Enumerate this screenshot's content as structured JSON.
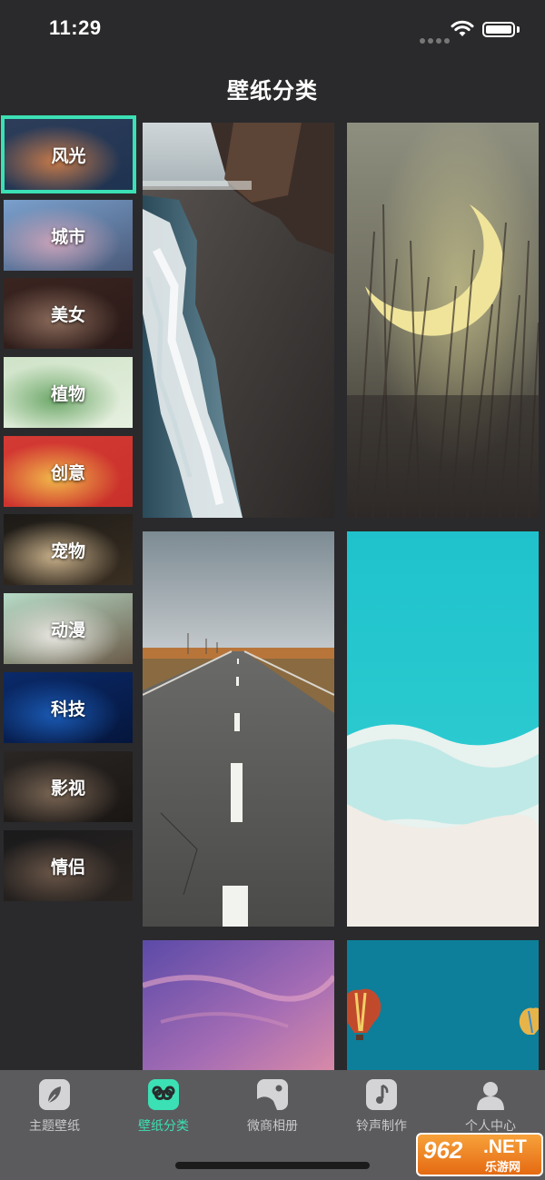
{
  "status_bar": {
    "time": "11:29"
  },
  "nav": {
    "title": "壁纸分类"
  },
  "categories": [
    {
      "label": "风光",
      "active": true,
      "colors": [
        "#2d3d5a",
        "#c67a4a",
        "#1e3350"
      ]
    },
    {
      "label": "城市",
      "active": false,
      "colors": [
        "#7aa0cc",
        "#c9a2b8",
        "#4a5a7a"
      ]
    },
    {
      "label": "美女",
      "active": false,
      "colors": [
        "#3a2420",
        "#8a6a5a",
        "#2a1a18"
      ]
    },
    {
      "label": "植物",
      "active": false,
      "colors": [
        "#cfe3c8",
        "#6ea86a",
        "#e6f0df"
      ]
    },
    {
      "label": "创意",
      "active": false,
      "colors": [
        "#d43a34",
        "#f2b84a",
        "#c9302a"
      ]
    },
    {
      "label": "宠物",
      "active": false,
      "colors": [
        "#1c1a17",
        "#c8b08a",
        "#3a2f22"
      ]
    },
    {
      "label": "动漫",
      "active": false,
      "colors": [
        "#b7dcc8",
        "#e8e6e0",
        "#6a5a48"
      ]
    },
    {
      "label": "科技",
      "active": false,
      "colors": [
        "#0a2a6a",
        "#1a5ab4",
        "#05163c"
      ]
    },
    {
      "label": "影视",
      "active": false,
      "colors": [
        "#2a2624",
        "#7a6654",
        "#1a1614"
      ]
    },
    {
      "label": "情侣",
      "active": false,
      "colors": [
        "#1a1a1c",
        "#6a5648",
        "#2a2420"
      ]
    }
  ],
  "wallpapers": [
    {
      "name": "coast-aerial"
    },
    {
      "name": "moon-grass"
    },
    {
      "name": "desert-road"
    },
    {
      "name": "turquoise-sea"
    },
    {
      "name": "purple-sky"
    },
    {
      "name": "balloons-teal"
    }
  ],
  "tabs": [
    {
      "label": "主题壁纸",
      "icon": "feather-icon",
      "active": false
    },
    {
      "label": "壁纸分类",
      "icon": "infinity-icon",
      "active": true
    },
    {
      "label": "微商相册",
      "icon": "album-icon",
      "active": false
    },
    {
      "label": "铃声制作",
      "icon": "music-note-icon",
      "active": false
    },
    {
      "label": "个人中心",
      "icon": "person-icon",
      "active": false
    }
  ],
  "watermark": {
    "number": "962",
    "net": ".NET",
    "sub": "乐游网"
  },
  "colors": {
    "accent": "#3be0b4",
    "background": "#2a2a2c",
    "tab_bar": "#5b5b5e"
  }
}
